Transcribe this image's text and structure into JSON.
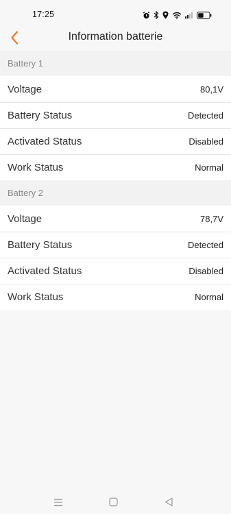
{
  "status_bar": {
    "time": "17:25",
    "icons": [
      "alarm-icon",
      "bluetooth-icon",
      "location-icon",
      "wifi-icon",
      "signal-icon",
      "battery-icon"
    ]
  },
  "header": {
    "back_icon": "chevron-left-icon",
    "title": "Information batterie",
    "accent_color": "#e8762c"
  },
  "batteries": [
    {
      "section_title": "Battery 1",
      "rows": [
        {
          "label": "Voltage",
          "value": "80,1V"
        },
        {
          "label": "Battery Status",
          "value": "Detected"
        },
        {
          "label": "Activated Status",
          "value": "Disabled"
        },
        {
          "label": "Work Status",
          "value": "Normal"
        }
      ]
    },
    {
      "section_title": "Battery 2",
      "rows": [
        {
          "label": "Voltage",
          "value": "78,7V"
        },
        {
          "label": "Battery Status",
          "value": "Detected"
        },
        {
          "label": "Activated Status",
          "value": "Disabled"
        },
        {
          "label": "Work Status",
          "value": "Normal"
        }
      ]
    }
  ],
  "nav_bar": {
    "buttons": [
      "menu-icon",
      "home-icon",
      "back-triangle-icon"
    ]
  }
}
